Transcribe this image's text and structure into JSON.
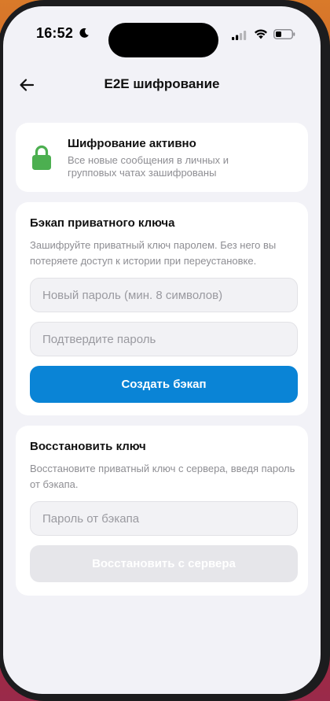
{
  "status_bar": {
    "time": "16:52"
  },
  "header": {
    "title": "E2E шифрование"
  },
  "encryption_status": {
    "title": "Шифрование активно",
    "description": "Все новые сообщения в личных и групповых чатах зашифрованы",
    "accent_color": "#4caf50"
  },
  "backup": {
    "title": "Бэкап приватного ключа",
    "description": "Зашифруйте приватный ключ паролем. Без него вы потеряете доступ к истории при переустановке.",
    "password_placeholder": "Новый пароль (мин. 8 символов)",
    "password_value": "",
    "confirm_placeholder": "Подтвердите пароль",
    "confirm_value": "",
    "button_label": "Создать бэкап",
    "button_color": "#0a84d6"
  },
  "restore": {
    "title": "Восстановить ключ",
    "description": "Восстановите приватный ключ с сервера, введя пароль от бэкапа.",
    "password_placeholder": "Пароль от бэкапа",
    "password_value": "",
    "button_label": "Восстановить с сервера",
    "button_enabled": false
  }
}
